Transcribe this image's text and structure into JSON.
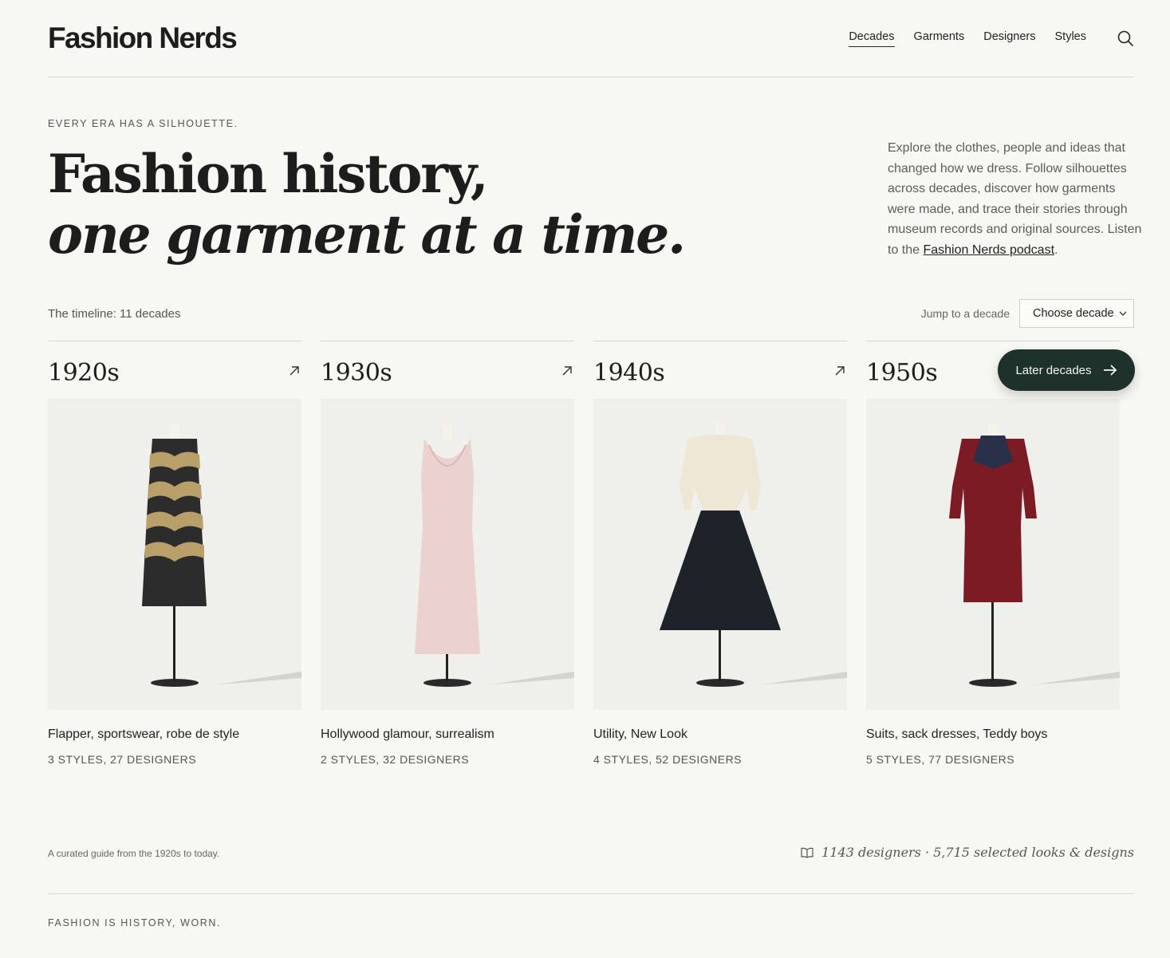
{
  "site": {
    "logo": "Fashion Nerds"
  },
  "nav": {
    "items": [
      {
        "label": "Decades"
      },
      {
        "label": "Garments"
      },
      {
        "label": "Designers"
      },
      {
        "label": "Styles"
      }
    ],
    "search_icon": "search-icon"
  },
  "hero": {
    "eyebrow": "EVERY ERA HAS A SILHOUETTE.",
    "headline_line1": "Fashion history,",
    "headline_line2": "one garment at a time.",
    "intro": "Explore the clothes, people and ideas that changed how we dress. Follow silhouettes across decades, discover how garments were made, and trace their stories through museum records and original sources. Listen to the ",
    "intro_link": "Fashion Nerds podcast",
    "intro_end": "."
  },
  "timeline": {
    "label": "The timeline: 11 decades",
    "jump_label": "Jump to a decade",
    "select_value": "Choose decade",
    "later_button": "Later decades"
  },
  "decades": [
    {
      "title": "1920s",
      "desc": "Flapper, sportswear, robe de style",
      "meta": "3 STYLES, 27 DESIGNERS"
    },
    {
      "title": "1930s",
      "desc": "Hollywood glamour, surrealism",
      "meta": "2 STYLES, 32 DESIGNERS"
    },
    {
      "title": "1940s",
      "desc": "Utility, New Look",
      "meta": "4 STYLES, 52 DESIGNERS"
    },
    {
      "title": "1950s",
      "desc": "Suits, sack dresses, Teddy boys",
      "meta": "5 STYLES, 77 DESIGNERS"
    }
  ],
  "footer": {
    "left": "A curated guide from the 1920s to today.",
    "stats": "1143 designers · 5,715 selected looks & designs",
    "book_icon": "book-icon",
    "tagline": "FASHION IS HISTORY, WORN."
  },
  "colors": {
    "background": "#f7f7f3",
    "button": "#1e312b",
    "text": "#222222"
  }
}
